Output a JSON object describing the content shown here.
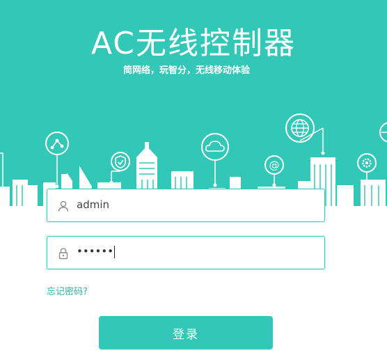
{
  "header": {
    "title": "AC无线控制器",
    "subtitle": "简网络，玩智分，无线移动体验"
  },
  "login": {
    "username_value": "admin",
    "password_value": "••••••",
    "forgot_label": "忘记密码?",
    "submit_label": "登录"
  },
  "colors": {
    "brand": "#33c7b8",
    "link": "#2fb2a4"
  },
  "icons": [
    "route-icon",
    "shield-icon",
    "cloud-icon",
    "email-icon",
    "globe-icon",
    "gear-icon",
    "user-icon",
    "lock-icon"
  ]
}
